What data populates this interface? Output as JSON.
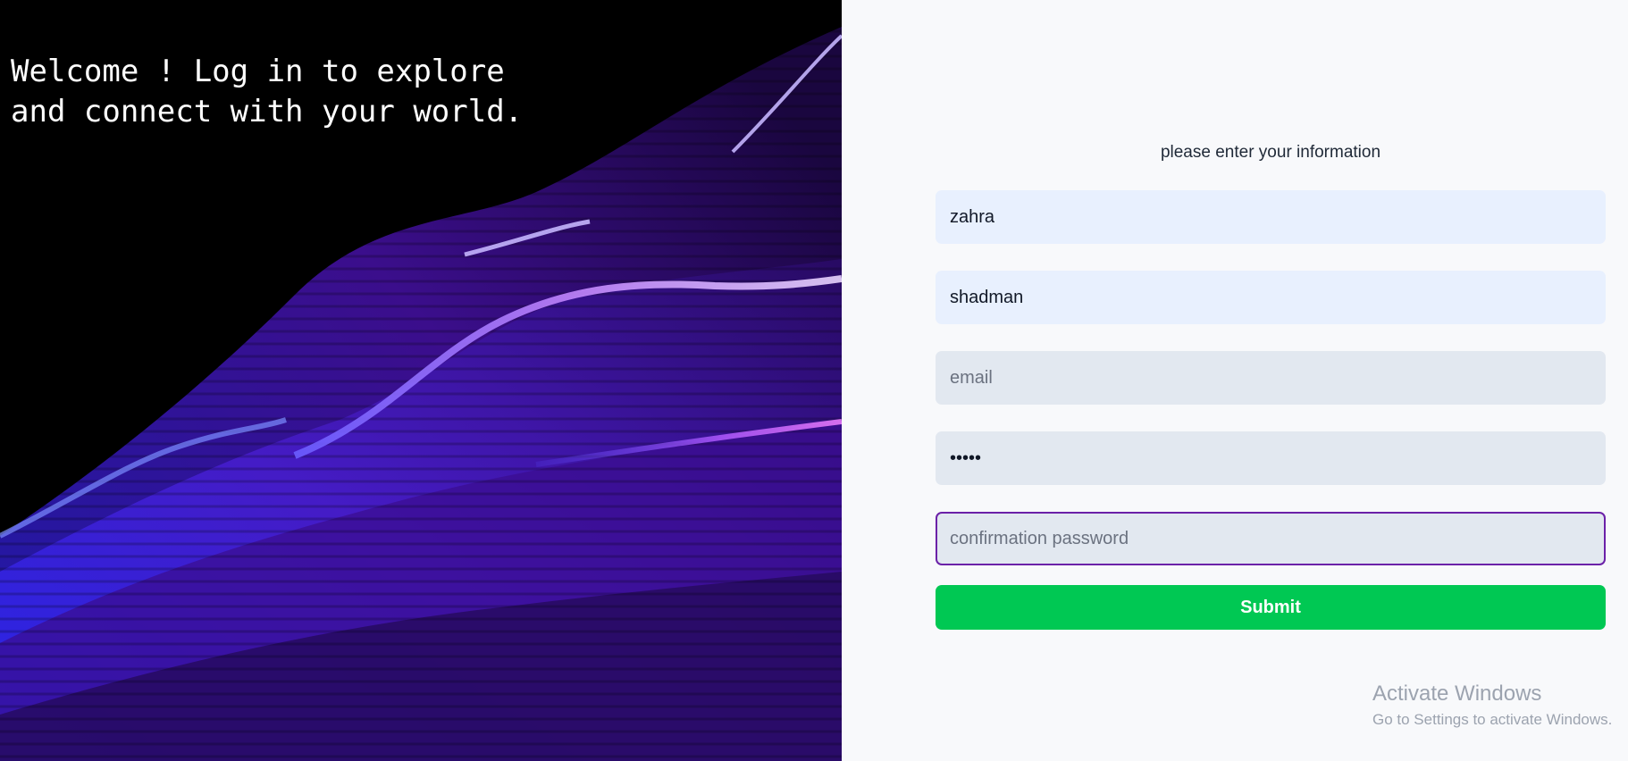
{
  "hero": {
    "welcome_text": "Welcome ! Log in to explore\nand connect with your world.",
    "accent_colors": [
      "#3b2bff",
      "#7c3aed",
      "#c026d3"
    ]
  },
  "form": {
    "heading": "please enter your information",
    "fields": [
      {
        "name": "first-name",
        "value": "zahra",
        "placeholder": "",
        "type": "text"
      },
      {
        "name": "last-name",
        "value": "shadman",
        "placeholder": "",
        "type": "text"
      },
      {
        "name": "email",
        "value": "",
        "placeholder": "email",
        "type": "email"
      },
      {
        "name": "password",
        "value": "•••••",
        "placeholder": "",
        "type": "password"
      },
      {
        "name": "confirm-password",
        "value": "",
        "placeholder": "confirmation password",
        "type": "password"
      }
    ],
    "submit_label": "Submit",
    "submit_color": "#00c853",
    "focus_color": "#6b21a8"
  },
  "watermark": {
    "title": "Activate Windows",
    "subtitle": "Go to Settings to activate Windows."
  }
}
